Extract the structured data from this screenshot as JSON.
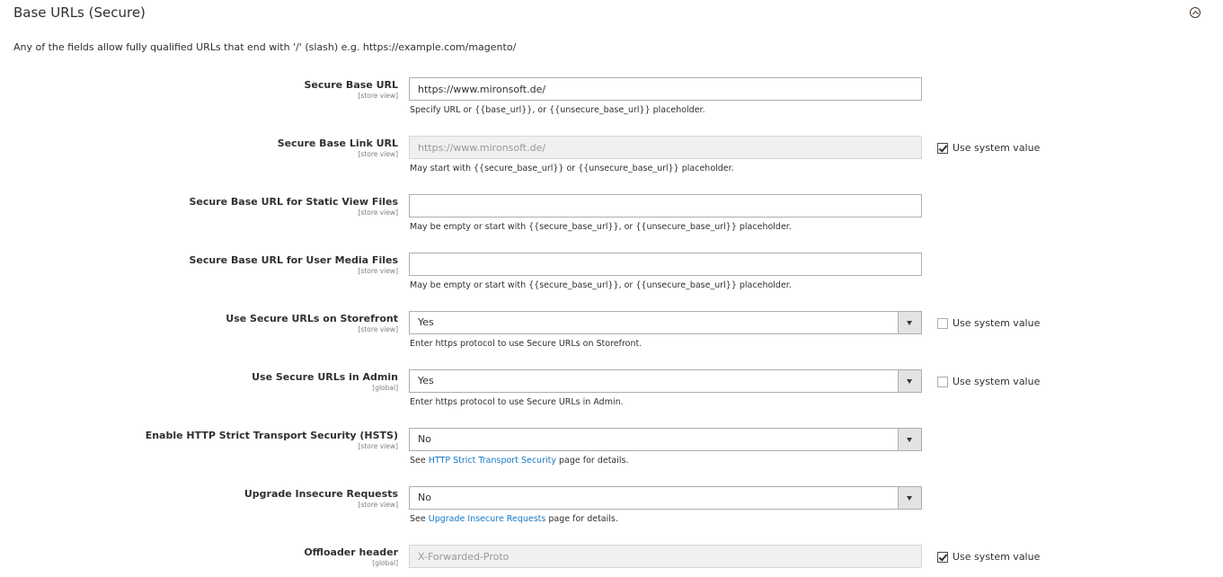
{
  "section": {
    "title": "Base URLs (Secure)",
    "description": "Any of the fields allow fully qualified URLs that end with '/' (slash) e.g. https://example.com/magento/"
  },
  "system_value_label": "Use system value",
  "fields": {
    "secure_base_url": {
      "label": "Secure Base URL",
      "scope": "[store view]",
      "value": "https://www.mironsoft.de/",
      "note": "Specify URL or {{base_url}}, or {{unsecure_base_url}} placeholder."
    },
    "secure_base_link_url": {
      "label": "Secure Base Link URL",
      "scope": "[store view]",
      "value": "https://www.mironsoft.de/",
      "note": "May start with {{secure_base_url}} or {{unsecure_base_url}} placeholder.",
      "use_system_value": true
    },
    "secure_base_static_url": {
      "label": "Secure Base URL for Static View Files",
      "scope": "[store view]",
      "value": "",
      "note": "May be empty or start with {{secure_base_url}}, or {{unsecure_base_url}} placeholder."
    },
    "secure_base_media_url": {
      "label": "Secure Base URL for User Media Files",
      "scope": "[store view]",
      "value": "",
      "note": "May be empty or start with {{secure_base_url}}, or {{unsecure_base_url}} placeholder."
    },
    "use_secure_frontend": {
      "label": "Use Secure URLs on Storefront",
      "scope": "[store view]",
      "value": "Yes",
      "note": "Enter https protocol to use Secure URLs on Storefront.",
      "use_system_value": false
    },
    "use_secure_admin": {
      "label": "Use Secure URLs in Admin",
      "scope": "[global]",
      "value": "Yes",
      "note": "Enter https protocol to use Secure URLs in Admin.",
      "use_system_value": false
    },
    "hsts": {
      "label": "Enable HTTP Strict Transport Security (HSTS)",
      "scope": "[store view]",
      "value": "No",
      "note_prefix": "See ",
      "note_link": "HTTP Strict Transport Security",
      "note_suffix": " page for details."
    },
    "upgrade_insecure": {
      "label": "Upgrade Insecure Requests",
      "scope": "[store view]",
      "value": "No",
      "note_prefix": "See ",
      "note_link": "Upgrade Insecure Requests",
      "note_suffix": " page for details."
    },
    "offloader_header": {
      "label": "Offloader header",
      "scope": "[global]",
      "value": "X-Forwarded-Proto",
      "use_system_value": true
    }
  },
  "colors": {
    "link": "#1979c3",
    "text": "#303030",
    "border": "#adadad",
    "disabled_bg": "#f0f0f0"
  }
}
